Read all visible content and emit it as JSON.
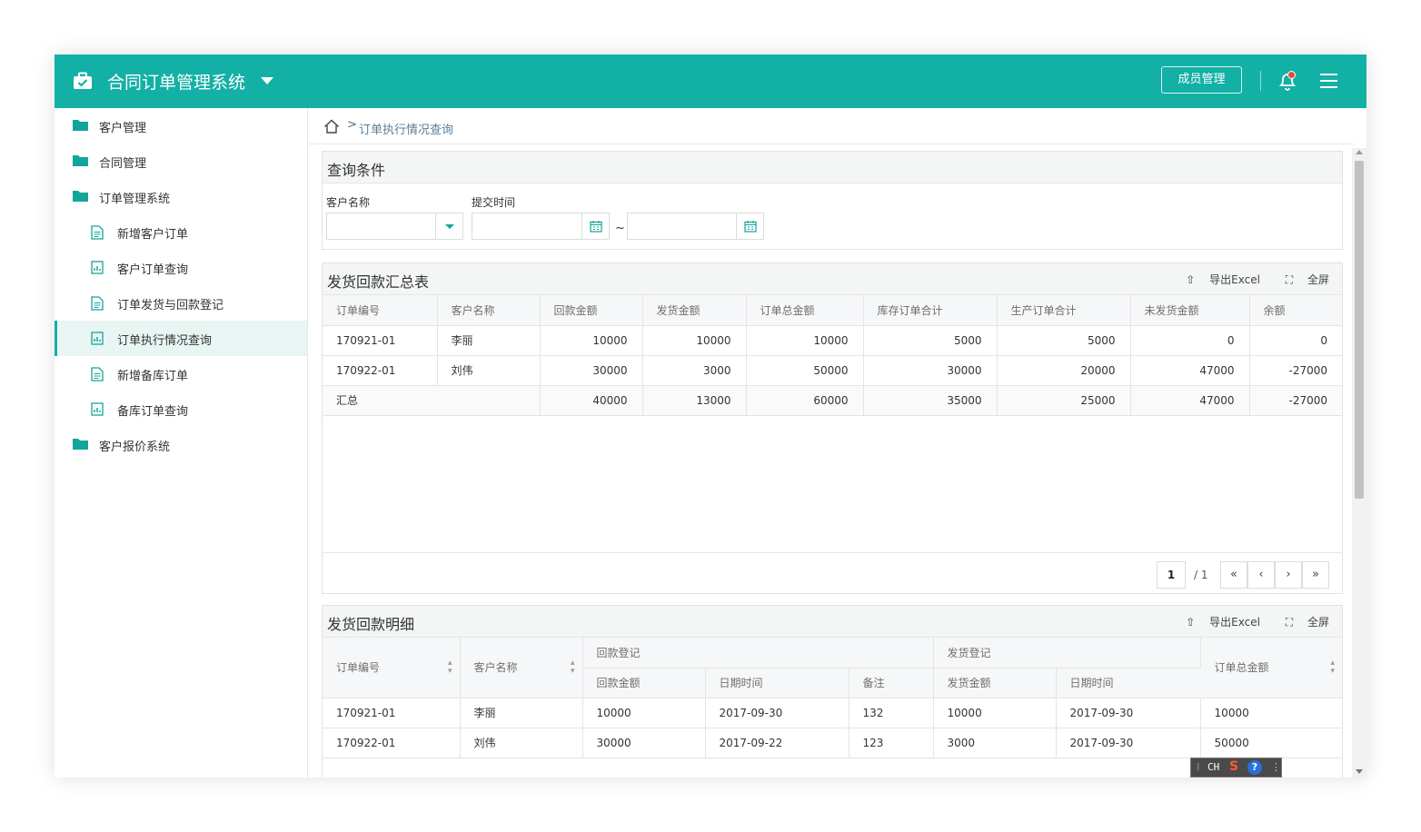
{
  "header": {
    "app_title": "合同订单管理系统",
    "member_button": "成员管理",
    "icons": [
      "briefcase-icon",
      "caret-down-icon",
      "bell-icon",
      "hamburger-menu-icon"
    ],
    "accent_color": "#13b0a5"
  },
  "sidebar": {
    "items": [
      {
        "label": "客户管理",
        "level": 1,
        "icon": "folder-icon"
      },
      {
        "label": "合同管理",
        "level": 1,
        "icon": "folder-icon"
      },
      {
        "label": "订单管理系统",
        "level": 1,
        "icon": "folder-icon"
      },
      {
        "label": "新增客户订单",
        "level": 2,
        "icon": "document-icon"
      },
      {
        "label": "客户订单查询",
        "level": 2,
        "icon": "report-icon"
      },
      {
        "label": "订单发货与回款登记",
        "level": 2,
        "icon": "document-icon"
      },
      {
        "label": "订单执行情况查询",
        "level": 2,
        "icon": "report-icon",
        "active": true
      },
      {
        "label": "新增备库订单",
        "level": 2,
        "icon": "document-icon"
      },
      {
        "label": "备库订单查询",
        "level": 2,
        "icon": "report-icon"
      },
      {
        "label": "客户报价系统",
        "level": 1,
        "icon": "folder-icon"
      }
    ]
  },
  "breadcrumb": {
    "separator": ">",
    "current": "订单执行情况查询"
  },
  "query": {
    "title": "查询条件",
    "customer_label": "客户名称",
    "customer_value": "",
    "time_label": "提交时间",
    "time_from": "",
    "time_to": "",
    "separator": "~"
  },
  "summary": {
    "title": "发货回款汇总表",
    "export_label": "导出Excel",
    "fullscreen_label": "全屏",
    "columns": [
      "订单编号",
      "客户名称",
      "回款金额",
      "发货金额",
      "订单总金额",
      "库存订单合计",
      "生产订单合计",
      "未发货金额",
      "余额"
    ],
    "rows": [
      [
        "170921-01",
        "李丽",
        "10000",
        "10000",
        "10000",
        "5000",
        "5000",
        "0",
        "0"
      ],
      [
        "170922-01",
        "刘伟",
        "30000",
        "3000",
        "50000",
        "30000",
        "20000",
        "47000",
        "-27000"
      ]
    ],
    "total": {
      "label": "汇总",
      "values": [
        "40000",
        "13000",
        "60000",
        "35000",
        "25000",
        "47000",
        "-27000"
      ]
    },
    "pager": {
      "page": "1",
      "total": "/ 1"
    }
  },
  "detail": {
    "title": "发货回款明细",
    "export_label": "导出Excel",
    "fullscreen_label": "全屏",
    "col_order_no": "订单编号",
    "col_customer": "客户名称",
    "group_payment": "回款登记",
    "group_shipment": "发货登记",
    "col_order_total": "订单总金额",
    "col_payment_amount": "回款金额",
    "col_payment_date": "日期时间",
    "col_note": "备注",
    "col_ship_amount": "发货金额",
    "col_ship_date": "日期时间",
    "rows": [
      [
        "170921-01",
        "李丽",
        "10000",
        "2017-09-30",
        "132",
        "10000",
        "2017-09-30",
        "10000"
      ],
      [
        "170922-01",
        "刘伟",
        "30000",
        "2017-09-22",
        "123",
        "3000",
        "2017-09-30",
        "50000"
      ]
    ]
  },
  "ime": {
    "label": "CH"
  }
}
